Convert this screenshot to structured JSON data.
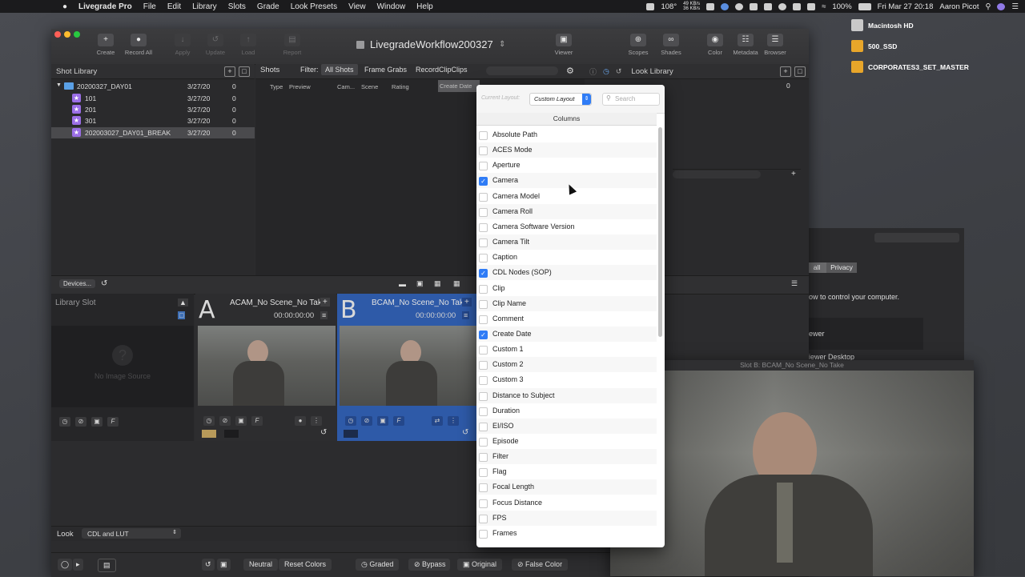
{
  "menubar": {
    "app": "Livegrade Pro",
    "menus": [
      "File",
      "Edit",
      "Library",
      "Slots",
      "Grade",
      "Look Presets",
      "View",
      "Window",
      "Help"
    ],
    "temp": "108°",
    "net_up": "49 KB/s",
    "net_down": "36 KB/s",
    "battery": "100%",
    "clock": "Fri Mar 27  20:18",
    "user": "Aaron Picot"
  },
  "desktop": {
    "icons": [
      "Macintosh HD",
      "500_SSD",
      "CORPORATES3_SET_MASTER"
    ]
  },
  "window": {
    "title": "LivegradeWorkflow200327",
    "toolbar_left": [
      "Create",
      "Record All",
      "Apply",
      "Update",
      "Load",
      "Report"
    ],
    "toolbar_viewer": "Viewer",
    "toolbar_right": [
      "Scopes",
      "Shades",
      "Color",
      "Metadata",
      "Browser"
    ]
  },
  "shot_library": {
    "title": "Shot Library",
    "rows": [
      {
        "name": "20200327_DAY01",
        "date": "3/27/20",
        "count": "0"
      },
      {
        "name": "101",
        "date": "3/27/20",
        "count": "0"
      },
      {
        "name": "201",
        "date": "3/27/20",
        "count": "0"
      },
      {
        "name": "301",
        "date": "3/27/20",
        "count": "0"
      },
      {
        "name": "202003027_DAY01_BREAK",
        "date": "3/27/20",
        "count": "0"
      }
    ]
  },
  "shots": {
    "title": "Shots",
    "filter_label": "Filter:",
    "filters": [
      "All Shots",
      "Frame Grabs",
      "RecordClipClips"
    ],
    "columns": [
      "Type",
      "Preview",
      "Cam...",
      "Scene",
      "Rating",
      "Create Date"
    ]
  },
  "look_library": {
    "title": "Look Library",
    "count": "0"
  },
  "devices": {
    "label": "Devices..."
  },
  "slots": {
    "library_slot": "Library Slot",
    "no_image": "No Image Source",
    "a": {
      "letter": "A",
      "name": "ACAM_No Scene_No Take",
      "tc": "00:00:00:00"
    },
    "b": {
      "letter": "B",
      "name": "BCAM_No Scene_No Take",
      "tc": "00:00:00:00"
    },
    "f_label": "F"
  },
  "look": {
    "label": "Look",
    "value": "CDL and LUT"
  },
  "bottom": {
    "neutral": "Neutral",
    "reset": "Reset Colors",
    "modes": [
      "Graded",
      "Bypass",
      "Original",
      "False Color"
    ]
  },
  "popover": {
    "layout_label": "Current Layout:",
    "layout_value": "Custom Layout",
    "search_placeholder": "Search",
    "columns_title": "Columns",
    "items": [
      {
        "label": "Absolute Path",
        "checked": false
      },
      {
        "label": "ACES Mode",
        "checked": false
      },
      {
        "label": "Aperture",
        "checked": false
      },
      {
        "label": "Camera",
        "checked": true
      },
      {
        "label": "Camera Model",
        "checked": false
      },
      {
        "label": "Camera Roll",
        "checked": false
      },
      {
        "label": "Camera Software Version",
        "checked": false
      },
      {
        "label": "Camera Tilt",
        "checked": false
      },
      {
        "label": "Caption",
        "checked": false
      },
      {
        "label": "CDL Nodes (SOP)",
        "checked": true
      },
      {
        "label": "Clip",
        "checked": false
      },
      {
        "label": "Clip Name",
        "checked": false
      },
      {
        "label": "Comment",
        "checked": false
      },
      {
        "label": "Create Date",
        "checked": true
      },
      {
        "label": "Custom 1",
        "checked": false
      },
      {
        "label": "Custom 2",
        "checked": false
      },
      {
        "label": "Custom 3",
        "checked": false
      },
      {
        "label": "Distance to Subject",
        "checked": false
      },
      {
        "label": "Duration",
        "checked": false
      },
      {
        "label": "EI/ISO",
        "checked": false
      },
      {
        "label": "Episode",
        "checked": false
      },
      {
        "label": "Filter",
        "checked": false
      },
      {
        "label": "Flag",
        "checked": false
      },
      {
        "label": "Focal Length",
        "checked": false
      },
      {
        "label": "Focus Distance",
        "checked": false
      },
      {
        "label": "FPS",
        "checked": false
      },
      {
        "label": "Frames",
        "checked": false
      }
    ]
  },
  "sysprefs": {
    "tab_all": "all",
    "tab_privacy": "Privacy",
    "text": "ow to control your computer.",
    "item1": "iewer",
    "item2": "iewer Desktop"
  },
  "viewer": {
    "title": "Slot B: BCAM_No Scene_No Take"
  }
}
